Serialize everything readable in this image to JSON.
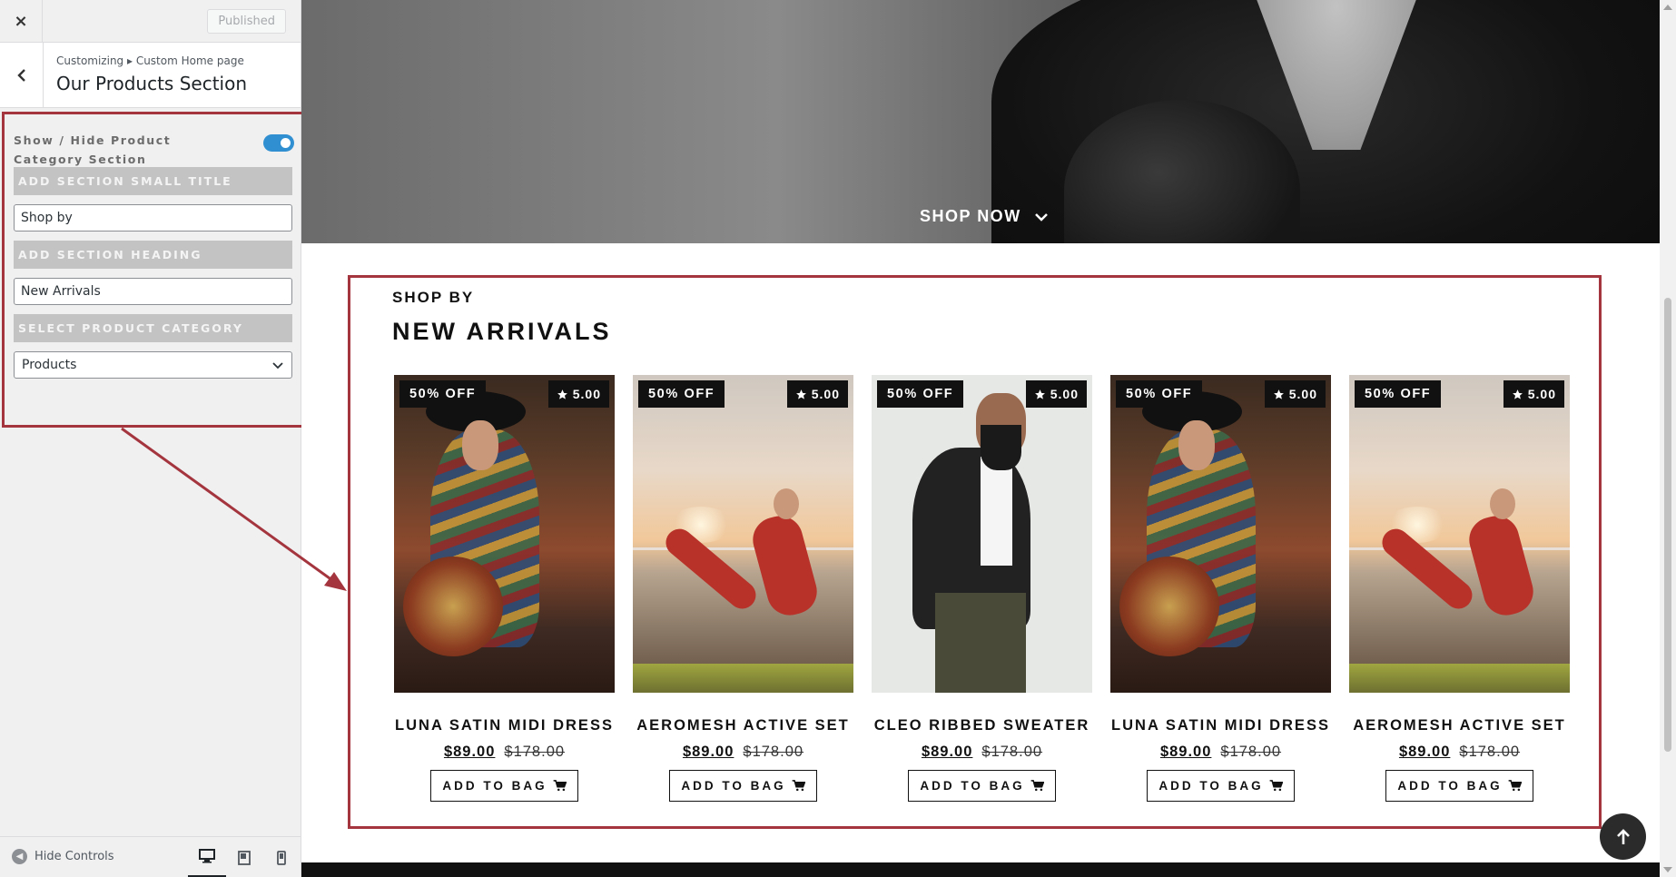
{
  "customizer": {
    "close_label": "×",
    "published_label": "Published",
    "breadcrumb": "Customizing ▸ Custom Home page",
    "panel_title": "Our Products Section",
    "toggle_label": "Show / Hide Product Category Section",
    "toggle_on": true,
    "small_title_heading": "ADD SECTION SMALL TITLE",
    "small_title_value": "Shop by",
    "section_heading_heading": "ADD SECTION HEADING",
    "section_heading_value": "New Arrivals",
    "category_heading": "SELECT PRODUCT CATEGORY",
    "category_value": "Products",
    "hide_controls_label": "Hide Controls",
    "devices": [
      "desktop-icon",
      "tablet-icon",
      "mobile-icon"
    ]
  },
  "hero": {
    "cta_label": "SHOP NOW"
  },
  "section": {
    "small_title": "SHOP BY",
    "heading": "NEW ARRIVALS"
  },
  "products": [
    {
      "title": "LUNA SATIN MIDI DRESS",
      "discount": "50% OFF",
      "rating": "5.00",
      "price": "$89.00",
      "old_price": "$178.00",
      "button": "ADD TO BAG",
      "image": "woman-knit"
    },
    {
      "title": "AEROMESH ACTIVE SET",
      "discount": "50% OFF",
      "rating": "5.00",
      "price": "$89.00",
      "old_price": "$178.00",
      "button": "ADD TO BAG",
      "image": "yoga"
    },
    {
      "title": "CLEO RIBBED SWEATER",
      "discount": "50% OFF",
      "rating": "5.00",
      "price": "$89.00",
      "old_price": "$178.00",
      "button": "ADD TO BAG",
      "image": "man-jacket"
    },
    {
      "title": "LUNA SATIN MIDI DRESS",
      "discount": "50% OFF",
      "rating": "5.00",
      "price": "$89.00",
      "old_price": "$178.00",
      "button": "ADD TO BAG",
      "image": "woman-knit"
    },
    {
      "title": "AEROMESH ACTIVE SET",
      "discount": "50% OFF",
      "rating": "5.00",
      "price": "$89.00",
      "old_price": "$178.00",
      "button": "ADD TO BAG",
      "image": "yoga"
    }
  ],
  "colors": {
    "accent_toggle": "#2f8fd0",
    "annotation": "#a4353e",
    "badge_bg": "#111111"
  }
}
